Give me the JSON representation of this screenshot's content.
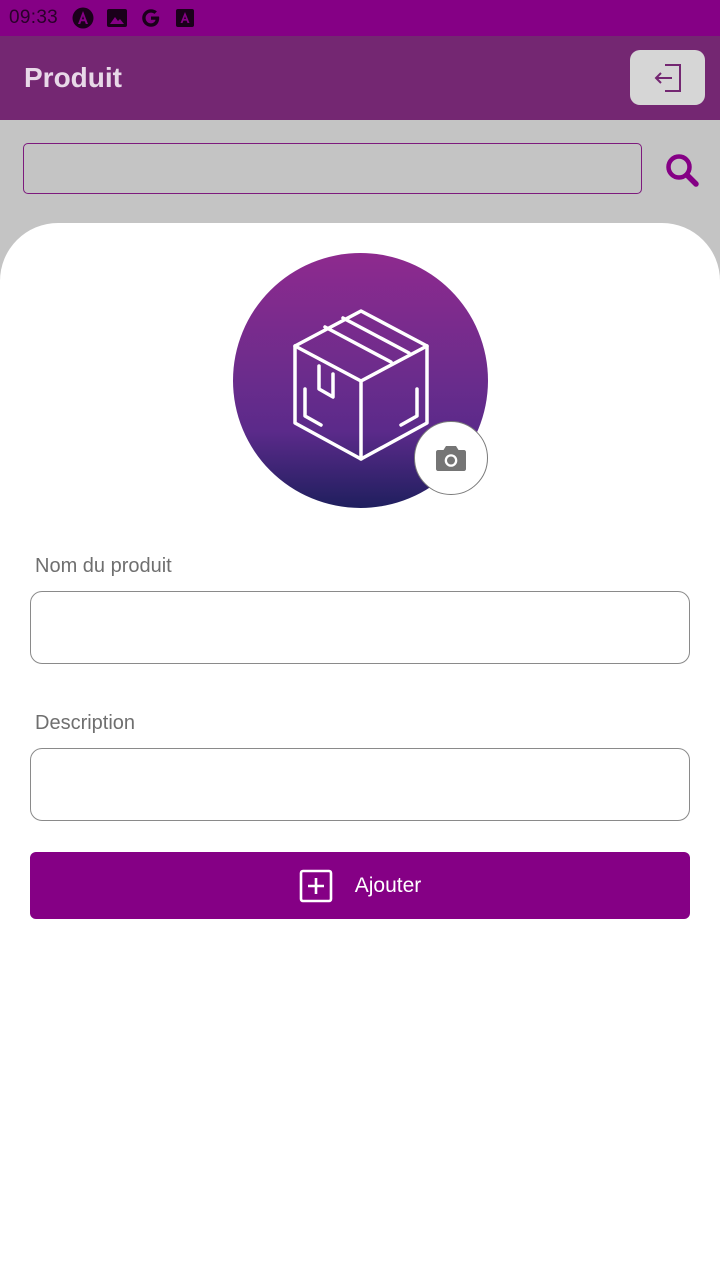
{
  "status_bar": {
    "time": "09:33",
    "icons": [
      "angular-icon",
      "image-icon",
      "google-icon",
      "app-notification-icon"
    ]
  },
  "app_bar": {
    "title": "Produit",
    "logout_icon": "logout-icon"
  },
  "search": {
    "value": "",
    "placeholder": "",
    "icon": "search-icon"
  },
  "product_image": {
    "icon": "box-icon",
    "camera_icon": "camera-icon"
  },
  "form": {
    "name_label": "Nom du produit",
    "name_value": "",
    "description_label": "Description",
    "description_value": "",
    "submit_label": "Ajouter",
    "submit_icon": "plus-square-icon"
  },
  "colors": {
    "primary": "#850085",
    "app_bar": "#742772",
    "search_bg": "#c4c4c4"
  }
}
